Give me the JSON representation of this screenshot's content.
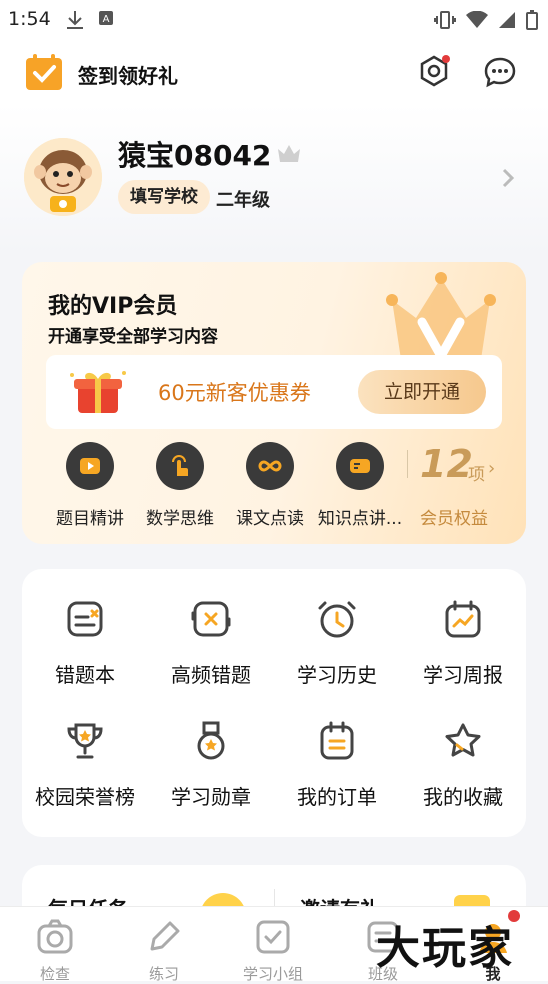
{
  "status_bar": {
    "time": "1:54"
  },
  "topbar": {
    "checkin_label": "签到领好礼"
  },
  "profile": {
    "username": "猿宝08042",
    "school_tag": "填写学校",
    "grade": "二年级"
  },
  "vip": {
    "title": "我的VIP会员",
    "subtitle": "开通享受全部学习内容",
    "coupon_text": "60元新客优惠券",
    "open_button": "立即开通",
    "items": [
      {
        "label": "题目精讲",
        "icon": "play-icon"
      },
      {
        "label": "数学思维",
        "icon": "tap-hand-icon"
      },
      {
        "label": "课文点读",
        "icon": "infinity-icon"
      },
      {
        "label": "知识点讲...",
        "icon": "card-icon"
      }
    ],
    "rights_count": "12",
    "rights_unit": "项",
    "rights_label": "会员权益"
  },
  "tools": [
    {
      "label": "错题本",
      "icon": "wrong-book-icon"
    },
    {
      "label": "高频错题",
      "icon": "frequent-mistake-icon"
    },
    {
      "label": "学习历史",
      "icon": "clock-icon"
    },
    {
      "label": "学习周报",
      "icon": "weekly-report-icon"
    },
    {
      "label": "校园荣誉榜",
      "icon": "trophy-icon"
    },
    {
      "label": "学习勋章",
      "icon": "medal-icon"
    },
    {
      "label": "我的订单",
      "icon": "order-icon"
    },
    {
      "label": "我的收藏",
      "icon": "star-icon"
    }
  ],
  "tasks": {
    "left_title": "每日任务",
    "right_title": "邀请有礼"
  },
  "tabbar": [
    {
      "label": "检查",
      "icon": "camera-icon",
      "active": false
    },
    {
      "label": "练习",
      "icon": "pencil-icon",
      "active": false
    },
    {
      "label": "学习小组",
      "icon": "group-check-icon",
      "active": false
    },
    {
      "label": "班级",
      "icon": "class-icon",
      "active": false
    },
    {
      "label": "我",
      "icon": "me-icon",
      "active": true
    }
  ],
  "watermark": "大玩家",
  "colors": {
    "accent": "#f6a623",
    "vip_gold": "#c99b59",
    "coupon_text": "#d9761a"
  }
}
